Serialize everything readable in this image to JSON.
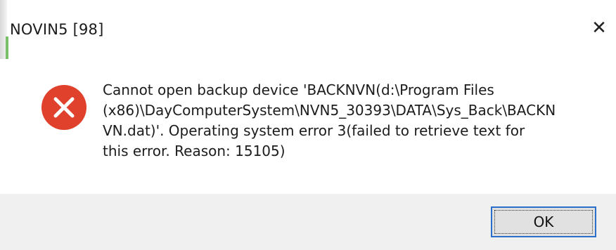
{
  "window": {
    "title": "NOVIN5 [98]",
    "close_symbol": "✕"
  },
  "message": {
    "icon": "error-icon",
    "text": "Cannot open backup device 'BACKNVN(d:\\Program Files\n(x86)\\DayComputerSystem\\NVN5_30393\\DATA\\Sys_Back\\BACKN\nVN.dat)'. Operating system error 3(failed to retrieve text for\nthis error. Reason: 15105)"
  },
  "buttons": {
    "ok_label": "OK"
  },
  "colors": {
    "error_red": "#e0412c",
    "focus_border": "#2a6fc9",
    "footer_bg": "#f0f0f0"
  }
}
